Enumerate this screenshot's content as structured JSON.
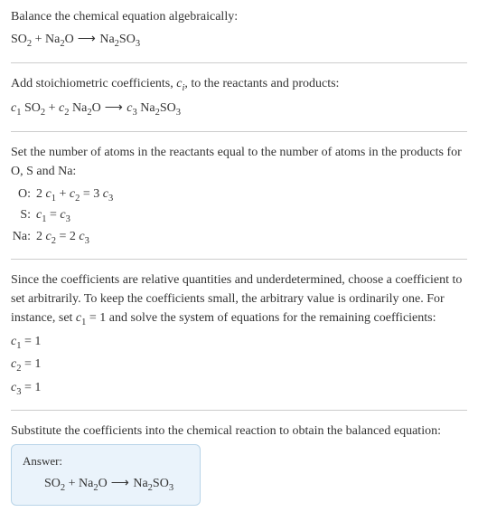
{
  "intro": {
    "line1": "Balance the chemical equation algebraically:",
    "eq_so2": "SO",
    "eq_so2_sub": "2",
    "plus1": " + Na",
    "na2o_sub1": "2",
    "na2o_o": "O",
    "arrow": " ⟶ ",
    "na2so3_na": "Na",
    "na2so3_sub1": "2",
    "na2so3_so": "SO",
    "na2so3_sub2": "3"
  },
  "stoich": {
    "text": "Add stoichiometric coefficients, ",
    "ci_c": "c",
    "ci_i": "i",
    "text2": ", to the reactants and products:",
    "c1": "c",
    "c1_sub": "1",
    "sp1": " SO",
    "so2_sub": "2",
    "plus": " + ",
    "c2": "c",
    "c2_sub": "2",
    "sp2": " Na",
    "na2_sub": "2",
    "o": "O",
    "arrow": " ⟶ ",
    "c3": "c",
    "c3_sub": "3",
    "sp3": " Na",
    "na2_sub2": "2",
    "so": "SO",
    "so3_sub": "3"
  },
  "atoms": {
    "intro": "Set the number of atoms in the reactants equal to the number of atoms in the products for O, S and Na:",
    "o_label": "O:",
    "o_eq_1": "2 ",
    "o_eq_c1": "c",
    "o_eq_c1s": "1",
    "o_eq_2": " + ",
    "o_eq_c2": "c",
    "o_eq_c2s": "2",
    "o_eq_3": " = 3 ",
    "o_eq_c3": "c",
    "o_eq_c3s": "3",
    "s_label": "S:",
    "s_eq_c1": "c",
    "s_eq_c1s": "1",
    "s_eq_mid": " = ",
    "s_eq_c3": "c",
    "s_eq_c3s": "3",
    "na_label": "Na:",
    "na_eq_1": "2 ",
    "na_eq_c2": "c",
    "na_eq_c2s": "2",
    "na_eq_mid": " = 2 ",
    "na_eq_c3": "c",
    "na_eq_c3s": "3"
  },
  "solve": {
    "p1a": "Since the coefficients are relative quantities and underdetermined, choose a coefficient to set arbitrarily. To keep the coefficients small, the arbitrary value is ordinarily one. For instance, set ",
    "c1": "c",
    "c1s": "1",
    "p1b": " = 1 and solve the system of equations for the remaining coefficients:",
    "l1_c": "c",
    "l1_s": "1",
    "l1_v": " = 1",
    "l2_c": "c",
    "l2_s": "2",
    "l2_v": " = 1",
    "l3_c": "c",
    "l3_s": "3",
    "l3_v": " = 1"
  },
  "final": {
    "text": "Substitute the coefficients into the chemical reaction to obtain the balanced equation:",
    "answer_label": "Answer:",
    "so2": "SO",
    "so2_sub": "2",
    "plus": " + Na",
    "na2_sub": "2",
    "o": "O",
    "arrow": " ⟶ ",
    "na": "Na",
    "na2_sub2": "2",
    "so": "SO",
    "so3_sub": "3"
  }
}
